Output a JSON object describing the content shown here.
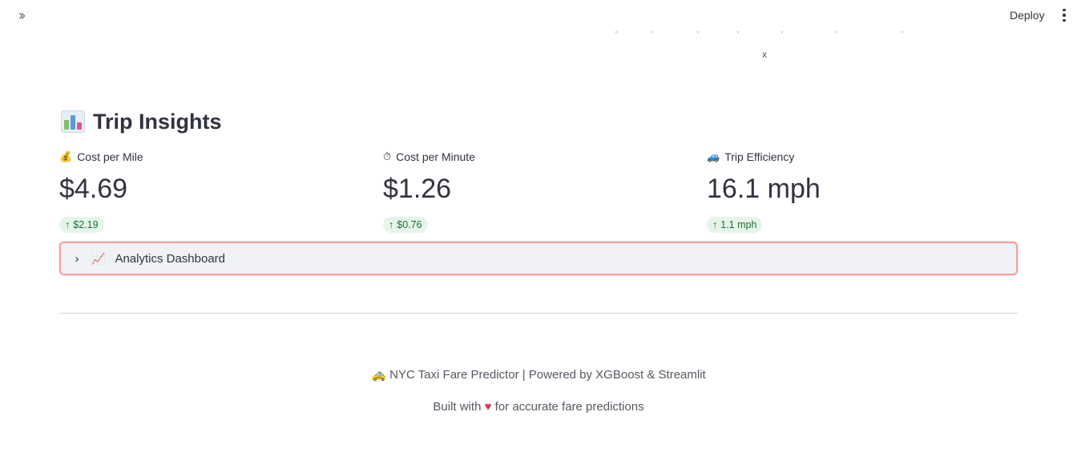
{
  "header": {
    "expand_icon": "double-chevron-right-icon",
    "deploy_label": "Deploy",
    "menu_icon": "vertical-ellipsis-icon"
  },
  "chart_remnant": {
    "x_axis_label": "x"
  },
  "insights": {
    "title": "Trip Insights",
    "title_icon": "bar-chart-icon",
    "metrics": [
      {
        "icon": "money-bag-icon",
        "label": "Cost per Mile",
        "value": "$4.69",
        "delta": "$2.19",
        "delta_direction": "up"
      },
      {
        "icon": "stopwatch-icon",
        "label": "Cost per Minute",
        "value": "$1.26",
        "delta": "$0.76",
        "delta_direction": "up"
      },
      {
        "icon": "car-icon",
        "label": "Trip Efficiency",
        "value": "16.1 mph",
        "delta": "1.1 mph",
        "delta_direction": "up"
      }
    ]
  },
  "expander": {
    "icon": "trending-up-chart-icon",
    "label": "Analytics Dashboard",
    "expanded": false
  },
  "footer": {
    "line1": "NYC Taxi Fare Predictor | Powered by XGBoost & Streamlit",
    "line1_icon": "taxi-icon",
    "line2_prefix": "Built with",
    "line2_icon": "heart-icon",
    "line2_suffix": "for accurate fare predictions"
  },
  "colors": {
    "delta_bg": "#e6f5ea",
    "delta_text": "#177233",
    "expander_border": "#f3a1a1",
    "expander_bg": "#f0f2f6",
    "heart": "#e8335a"
  }
}
